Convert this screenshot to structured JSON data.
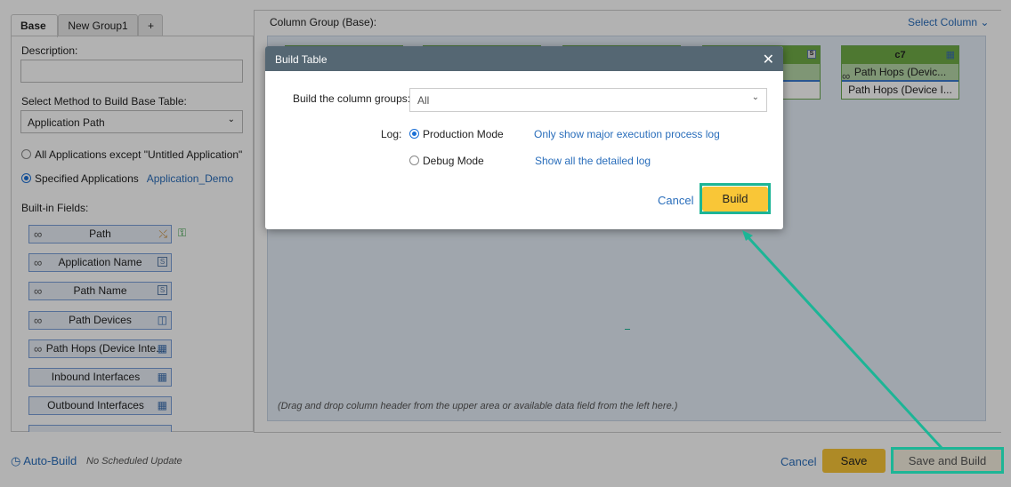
{
  "tabs": [
    "Base",
    "New Group1",
    "+"
  ],
  "left": {
    "description_label": "Description:",
    "description_value": "",
    "method_label": "Select Method to Build Base Table:",
    "method_value": "Application Path",
    "radio_all": "All Applications except \"Untitled Application\"",
    "radio_specified": "Specified Applications",
    "specified_link": "Application_Demo",
    "builtin_label": "Built-in Fields:",
    "fields": [
      "Path",
      "Application Name",
      "Path Name",
      "Path Devices",
      "Path Hops (Device Inte...",
      "Inbound Interfaces",
      "Outbound Interfaces"
    ]
  },
  "right": {
    "title": "Column Group (Base):",
    "select_column": "Select Column",
    "card_c7": {
      "header": "c7",
      "row1": "Path Hops (Devic...",
      "row2": "Path Hops (Device I..."
    },
    "hint": "(Drag and drop column header from the upper area or available data field from the left here.)"
  },
  "footer": {
    "auto_build": "Auto-Build",
    "schedule": "No Scheduled Update",
    "cancel": "Cancel",
    "save": "Save",
    "save_build": "Save and Build"
  },
  "modal": {
    "title": "Build Table",
    "groups_label": "Build the column groups:",
    "groups_value": "All",
    "log_label": "Log:",
    "production": "Production Mode",
    "production_desc": "Only show major execution process log",
    "debug": "Debug Mode",
    "debug_desc": "Show all the detailed log",
    "cancel": "Cancel",
    "build": "Build"
  },
  "colors": {
    "accent": "#1db596",
    "build": "#f9c637",
    "header": "#556773"
  }
}
